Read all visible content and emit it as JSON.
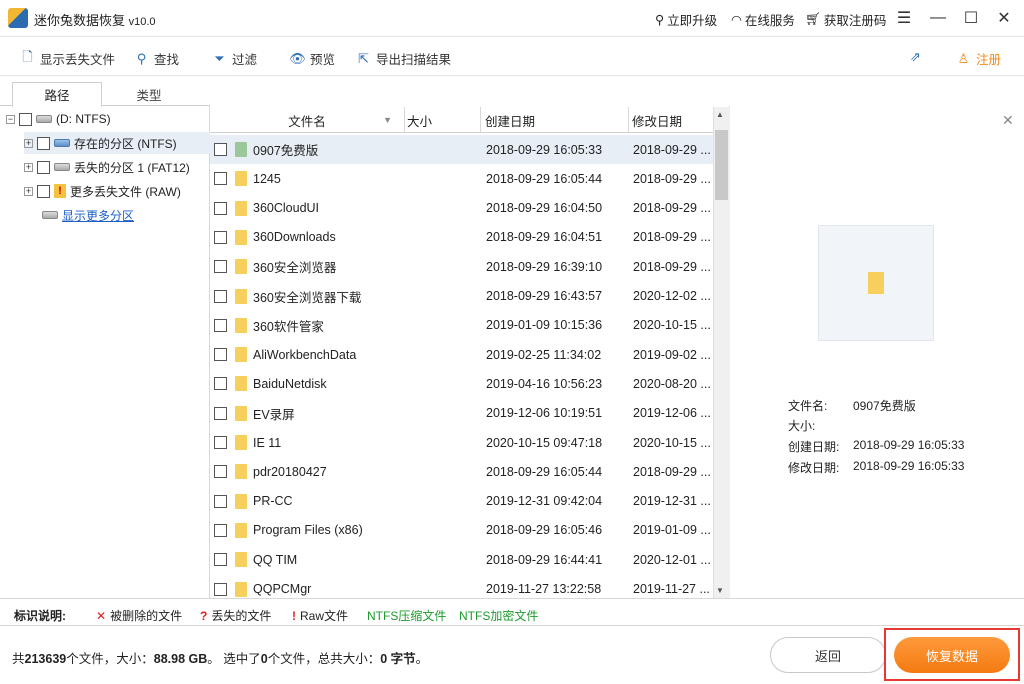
{
  "window": {
    "title": "迷你兔数据恢复",
    "version": "v10.0",
    "links": [
      {
        "label": "立即升级",
        "icon": "magnifier-upgrade-icon"
      },
      {
        "label": "在线服务",
        "icon": "headset-icon"
      },
      {
        "label": "获取注册码",
        "icon": "cart-icon"
      }
    ]
  },
  "toolbar": {
    "show_lost": "显示丢失文件",
    "find": "查找",
    "filter": "过滤",
    "preview": "预览",
    "export": "导出扫描结果",
    "register": "注册"
  },
  "tabs": {
    "path": "路径",
    "type": "类型"
  },
  "tree": {
    "root": "(D: NTFS)",
    "items": [
      {
        "label": "存在的分区 (NTFS)"
      },
      {
        "label": "丢失的分区 1 (FAT12)"
      },
      {
        "label": "更多丢失文件 (RAW)"
      }
    ],
    "show_more": "显示更多分区"
  },
  "columns": {
    "name": "文件名",
    "size": "大小",
    "created": "创建日期",
    "modified": "修改日期"
  },
  "files": [
    {
      "name": "0907免费版",
      "created": "2018-09-29 16:05:33",
      "modified": "2018-09-29 ..."
    },
    {
      "name": "1245",
      "created": "2018-09-29 16:05:44",
      "modified": "2018-09-29 ..."
    },
    {
      "name": "360CloudUI",
      "created": "2018-09-29 16:04:50",
      "modified": "2018-09-29 ..."
    },
    {
      "name": "360Downloads",
      "created": "2018-09-29 16:04:51",
      "modified": "2018-09-29 ..."
    },
    {
      "name": "360安全浏览器",
      "created": "2018-09-29 16:39:10",
      "modified": "2018-09-29 ..."
    },
    {
      "name": "360安全浏览器下载",
      "created": "2018-09-29 16:43:57",
      "modified": "2020-12-02 ..."
    },
    {
      "name": "360软件管家",
      "created": "2019-01-09 10:15:36",
      "modified": "2020-10-15 ..."
    },
    {
      "name": "AliWorkbenchData",
      "created": "2019-02-25 11:34:02",
      "modified": "2019-09-02 ..."
    },
    {
      "name": "BaiduNetdisk",
      "created": "2019-04-16 10:56:23",
      "modified": "2020-08-20 ..."
    },
    {
      "name": "EV录屏",
      "created": "2019-12-06 10:19:51",
      "modified": "2019-12-06 ..."
    },
    {
      "name": "IE 11",
      "created": "2020-10-15 09:47:18",
      "modified": "2020-10-15 ..."
    },
    {
      "name": "pdr20180427",
      "created": "2018-09-29 16:05:44",
      "modified": "2018-09-29 ..."
    },
    {
      "name": "PR-CC",
      "created": "2019-12-31 09:42:04",
      "modified": "2019-12-31 ..."
    },
    {
      "name": "Program Files (x86)",
      "created": "2018-09-29 16:05:46",
      "modified": "2019-01-09 ..."
    },
    {
      "name": "QQ TIM",
      "created": "2018-09-29 16:44:41",
      "modified": "2020-12-01 ..."
    },
    {
      "name": "QQPCMgr",
      "created": "2019-11-27 13:22:58",
      "modified": "2019-11-27 ..."
    }
  ],
  "preview": {
    "labels": {
      "name": "文件名:",
      "size": "大小:",
      "created": "创建日期:",
      "modified": "修改日期:"
    },
    "values": {
      "name": "0907免费版",
      "size": "",
      "created": "2018-09-29 16:05:33",
      "modified": "2018-09-29 16:05:33"
    }
  },
  "legend": {
    "title": "标识说明:",
    "deleted": "被删除的文件",
    "lost": "丢失的文件",
    "raw": "Raw文件",
    "ntfs_compressed": "NTFS压缩文件",
    "ntfs_encrypted": "NTFS加密文件",
    "colors": {
      "deleted": "#e02020",
      "lost": "#e02020",
      "raw": "#e02020",
      "ntfs": "#1e9a2e"
    }
  },
  "status": {
    "prefix": "共",
    "file_count": "213639",
    "files_size_label": "个文件，大小：",
    "total_size": "88.98 GB",
    "selected_label": "。 选中了",
    "selected_count": "0",
    "selected_suffix": "个文件，总共大小：",
    "selected_size": "0 字节",
    "end": "。"
  },
  "buttons": {
    "back": "返回",
    "recover": "恢复数据"
  }
}
